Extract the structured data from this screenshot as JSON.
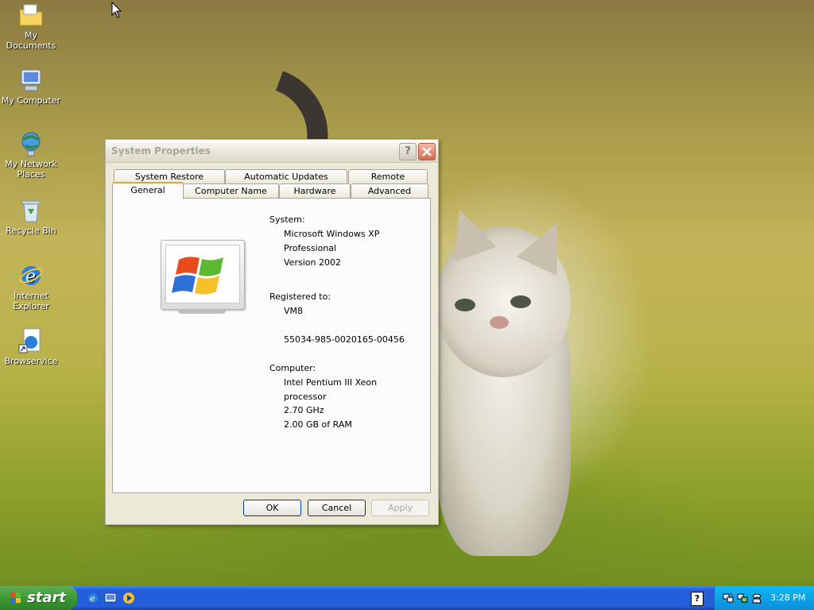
{
  "desktop": {
    "icons": [
      {
        "label": "My Documents"
      },
      {
        "label": "My Computer"
      },
      {
        "label": "My Network Places"
      },
      {
        "label": "Recycle Bin"
      },
      {
        "label": "Internet Explorer"
      },
      {
        "label": "Browservice"
      }
    ]
  },
  "dialog": {
    "title": "System Properties",
    "tabs_row1": [
      {
        "label": "System Restore"
      },
      {
        "label": "Automatic Updates"
      },
      {
        "label": "Remote"
      }
    ],
    "tabs_row2": [
      {
        "label": "General",
        "active": true
      },
      {
        "label": "Computer Name"
      },
      {
        "label": "Hardware"
      },
      {
        "label": "Advanced"
      }
    ],
    "system": {
      "heading": "System:",
      "os_name": "Microsoft Windows XP",
      "edition": "Professional",
      "version": "Version 2002"
    },
    "registered": {
      "heading": "Registered to:",
      "owner": "VM8",
      "product_id": "55034-985-0020165-00456"
    },
    "computer": {
      "heading": "Computer:",
      "cpu_line1": "Intel Pentium III Xeon",
      "cpu_line2": "processor",
      "speed": "2.70 GHz",
      "ram": "2.00 GB of RAM"
    },
    "buttons": {
      "ok": "OK",
      "cancel": "Cancel",
      "apply": "Apply"
    }
  },
  "taskbar": {
    "start_label": "start",
    "clock": "3:28 PM",
    "quick_launch": [
      "internet-explorer-icon",
      "show-desktop-icon",
      "media-player-icon"
    ]
  },
  "colors": {
    "taskbar_blue": "#245edb",
    "start_green": "#3c9a33",
    "tab_highlight": "#f0a030"
  }
}
